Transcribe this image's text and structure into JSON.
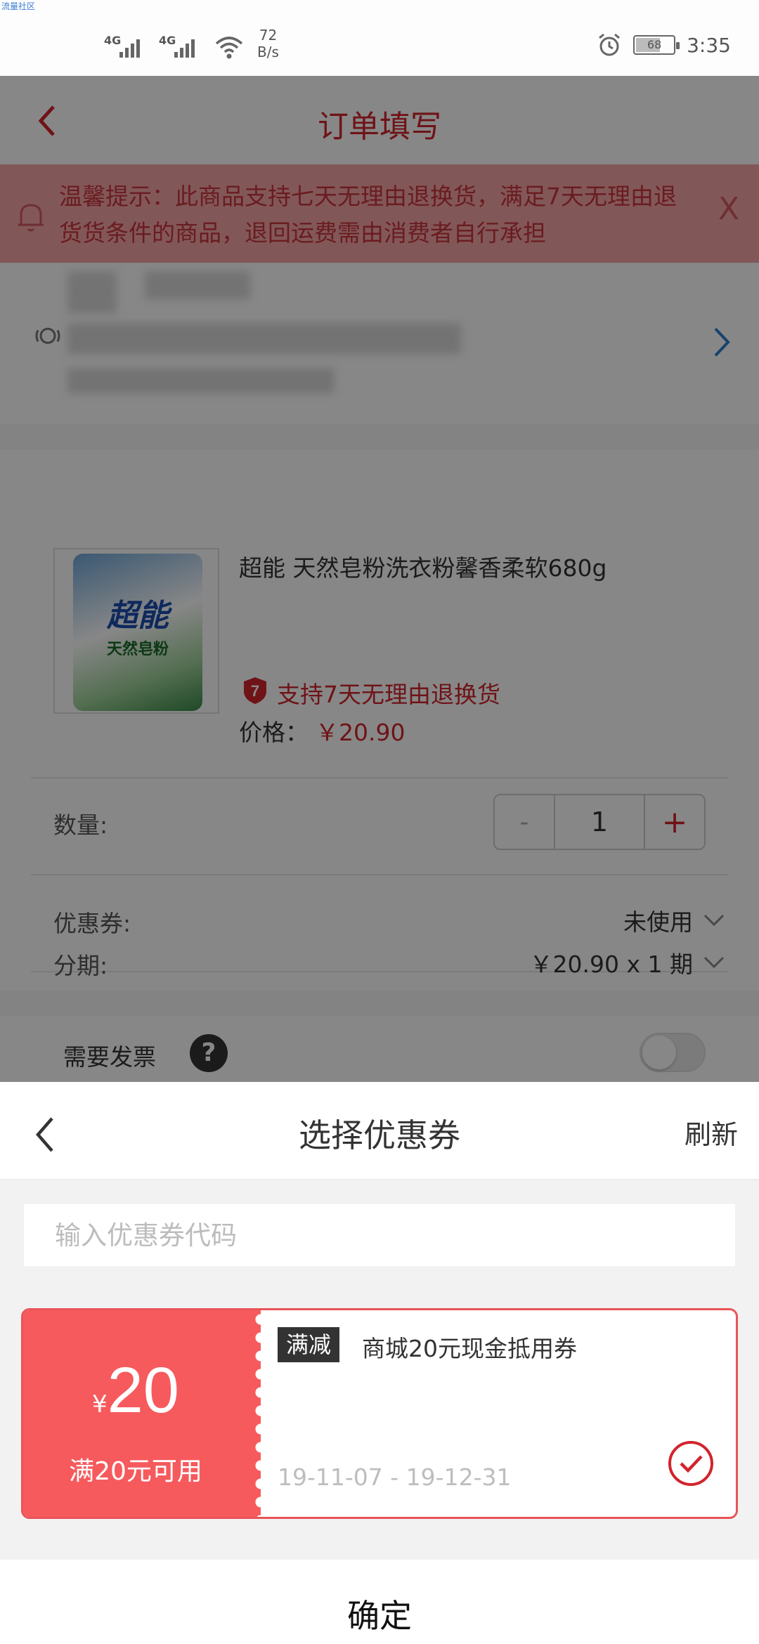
{
  "status_bar": {
    "corner_tag": "流量社区",
    "network_1": "4G",
    "network_2": "4G",
    "speed_value": "72",
    "speed_unit": "B/s",
    "battery": "68",
    "time": "3:35"
  },
  "background_page": {
    "title": "订单填写",
    "notice": "温馨提示：此商品支持七天无理由退换货，满足7天无理由退货货条件的商品，退回运费需由消费者自行承担",
    "notice_close": "X",
    "product": {
      "name": "超能 天然皂粉洗衣粉馨香柔软680g",
      "thumb_brand": "超能",
      "thumb_sub": "天然皂粉",
      "return_badge": "7",
      "return_policy": "支持7天无理由退换货",
      "price_label": "价格：",
      "price_value": "￥20.90"
    },
    "quantity": {
      "label": "数量:",
      "minus": "-",
      "value": "1",
      "plus": "+"
    },
    "coupon_row": {
      "label": "优惠券:",
      "value": "未使用"
    },
    "installment_row": {
      "label": "分期:",
      "value": "￥20.90 x 1 期"
    },
    "invoice": {
      "label": "需要发票",
      "help": "?"
    }
  },
  "coupon_sheet": {
    "title": "选择优惠券",
    "refresh": "刷新",
    "input_placeholder": "输入优惠券代码",
    "coupons": [
      {
        "currency": "¥",
        "amount": "20",
        "condition": "满20元可用",
        "tag": "满减",
        "name": "商城20元现金抵用券",
        "validity": "19-11-07 - 19-12-31",
        "selected": true
      }
    ],
    "confirm": "确定"
  },
  "colors": {
    "accent_red": "#d2242c",
    "coupon_red": "#f65a5d",
    "notice_bg": "#f6a4a6"
  }
}
